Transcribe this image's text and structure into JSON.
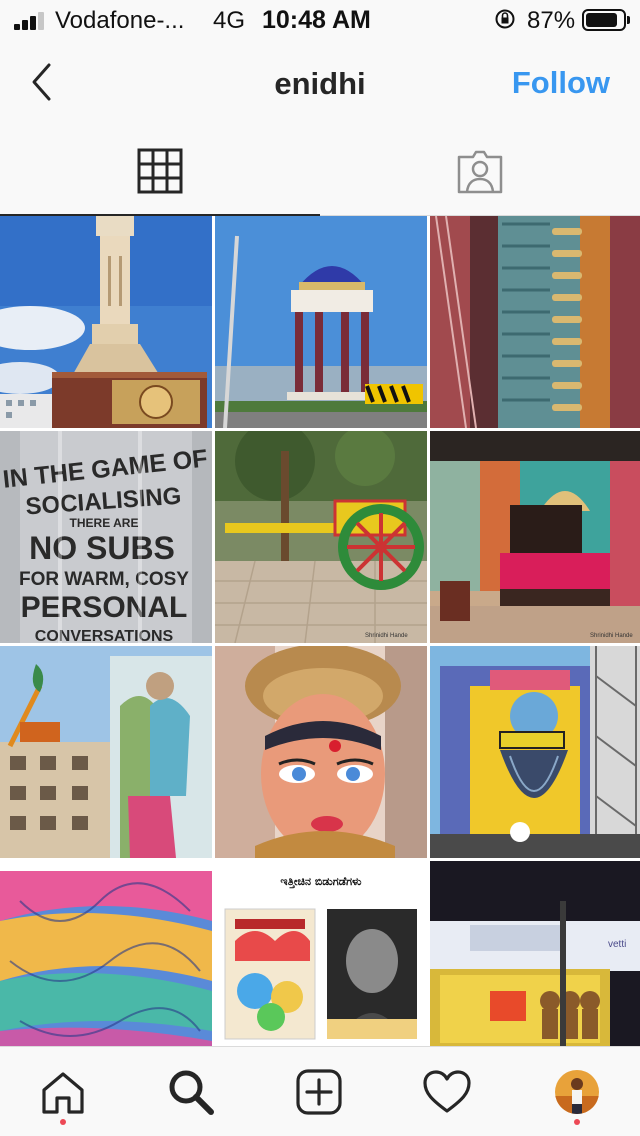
{
  "status_bar": {
    "carrier": "Vodafone-...",
    "network": "4G",
    "time": "10:48 AM",
    "battery_percent": "87%",
    "battery_level": 0.87,
    "signal_bars": 3
  },
  "header": {
    "back_icon": "chevron-left-icon",
    "username": "enidhi",
    "follow_label": "Follow",
    "follow_color": "#3897f0"
  },
  "tabs": [
    {
      "name": "grid",
      "icon": "grid-icon",
      "active": true
    },
    {
      "name": "tagged",
      "icon": "tagged-person-icon",
      "active": false
    }
  ],
  "posts": [
    {
      "subject": "clock tower",
      "text": ""
    },
    {
      "subject": "domed pavilion",
      "text": ""
    },
    {
      "subject": "bullet belts",
      "text": ""
    },
    {
      "subject": "socialising sign",
      "text_lines": [
        "IN THE GAME OF",
        "SOCIALISING",
        "THERE ARE",
        "NO SUBS",
        "FOR WARM, COSY",
        "PERSONAL",
        "CONVERSATIONS"
      ]
    },
    {
      "subject": "yellow bullock cart",
      "text": "Shrinidhi Hande"
    },
    {
      "subject": "decorated bedroom",
      "text": "Shrinidhi Hande"
    },
    {
      "subject": "building mural with crane",
      "text": ""
    },
    {
      "subject": "painted doll face",
      "text": ""
    },
    {
      "subject": "bearded man mural",
      "text": ""
    },
    {
      "subject": "colorful building mural",
      "text": ""
    },
    {
      "subject": "book covers",
      "text": "ಇತ್ತೀಚಿನ ಬಿಡುಗಡೆಗಳು"
    },
    {
      "subject": "night billboards",
      "text": "vetti"
    }
  ],
  "bottom_nav": [
    {
      "name": "home",
      "icon": "home-icon",
      "dot": true
    },
    {
      "name": "search",
      "icon": "search-icon",
      "dot": false
    },
    {
      "name": "new-post",
      "icon": "plus-square-icon",
      "dot": false
    },
    {
      "name": "activity",
      "icon": "heart-icon",
      "dot": false
    },
    {
      "name": "profile",
      "icon": "profile-avatar",
      "dot": true
    }
  ],
  "colors": {
    "notification_dot": "#ed4956",
    "bar_background": "#f9f9f9"
  }
}
